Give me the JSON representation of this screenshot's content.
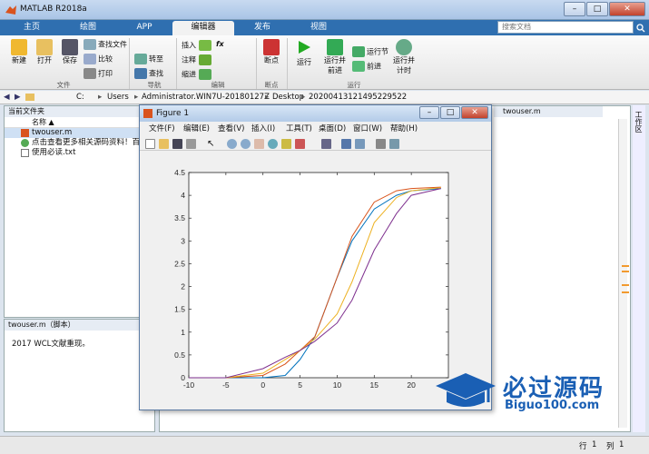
{
  "window": {
    "title": "MATLAB R2018a",
    "min": "–",
    "max": "□",
    "close": "✕"
  },
  "tabs": [
    "主页",
    "绘图",
    "APP",
    "编辑器",
    "发布",
    "视图"
  ],
  "search": {
    "placeholder": "搜索文档"
  },
  "ribbon": {
    "file": {
      "new": "新建",
      "open": "打开",
      "save": "保存",
      "find_files": "查找文件",
      "compare": "比较",
      "print": "打印",
      "group": "文件"
    },
    "nav": {
      "goto": "转至",
      "find": "查找",
      "group": "导航"
    },
    "edit": {
      "insert": "插入",
      "comment": "注释",
      "indent": "缩进",
      "fx": "fx",
      "group": "编辑"
    },
    "breakpoints": {
      "breakpoint": "断点",
      "group": "断点"
    },
    "run": {
      "run": "运行",
      "run_advance": "运行并\n前进",
      "run_section": "运行节",
      "advance": "前进",
      "run_time": "运行并\n计时",
      "group": "运行"
    }
  },
  "address": {
    "path": [
      "C:",
      "Users",
      "Administrator.WIN7U-20180127Z",
      "Desktop",
      "20200413121495229522"
    ]
  },
  "current_folder": {
    "title": "当前文件夹",
    "column": "名称 ▲",
    "files": [
      {
        "name": "twouser.m",
        "selected": true
      },
      {
        "name": "点击查看更多相关源码资料！百万",
        "selected": false
      },
      {
        "name": "使用必读.txt",
        "selected": false
      }
    ]
  },
  "details": {
    "title": "twouser.m（脚本）",
    "text": "2017 WCL文献重现。"
  },
  "editor": {
    "tab": "twouser.m"
  },
  "right_strip": {
    "label": "工作区"
  },
  "status": {
    "row_label": "行",
    "row": "1",
    "col_label": "列",
    "col": "1"
  },
  "figure": {
    "title": "Figure 1",
    "menus": [
      "文件(F)",
      "编辑(E)",
      "查看(V)",
      "插入(I)",
      "工具(T)",
      "桌面(D)",
      "窗口(W)",
      "帮助(H)"
    ]
  },
  "chart_data": {
    "type": "line",
    "xlim": [
      -10,
      25
    ],
    "ylim": [
      0,
      4.5
    ],
    "xticks": [
      -10,
      -5,
      0,
      5,
      10,
      15,
      20
    ],
    "yticks": [
      0,
      0.5,
      1,
      1.5,
      2,
      2.5,
      3,
      3.5,
      4,
      4.5
    ],
    "grid": false,
    "series": [
      {
        "color": "#0072bd",
        "x": [
          -10,
          -5,
          0,
          3,
          5,
          7,
          10,
          12,
          15,
          18,
          20,
          24
        ],
        "y": [
          0,
          0,
          0,
          0.05,
          0.4,
          0.9,
          2.2,
          3.0,
          3.7,
          4.0,
          4.1,
          4.15
        ]
      },
      {
        "color": "#d95319",
        "x": [
          -10,
          -5,
          0,
          3,
          5,
          7,
          10,
          12,
          15,
          18,
          20,
          24
        ],
        "y": [
          0,
          0,
          0.05,
          0.3,
          0.6,
          0.9,
          2.2,
          3.1,
          3.85,
          4.1,
          4.15,
          4.18
        ]
      },
      {
        "color": "#edb120",
        "x": [
          -10,
          -5,
          0,
          3,
          5,
          7,
          10,
          12,
          15,
          18,
          20,
          24
        ],
        "y": [
          0,
          0,
          0.1,
          0.4,
          0.6,
          0.85,
          1.4,
          2.1,
          3.4,
          3.95,
          4.1,
          4.17
        ]
      },
      {
        "color": "#7e2f8e",
        "x": [
          -10,
          -5,
          0,
          3,
          5,
          7,
          10,
          12,
          15,
          18,
          20,
          24
        ],
        "y": [
          0,
          0,
          0.2,
          0.45,
          0.6,
          0.8,
          1.2,
          1.7,
          2.8,
          3.6,
          4.0,
          4.15
        ]
      }
    ]
  },
  "logo": {
    "cn": "必过源码",
    "url": "Biguo100.com"
  },
  "colors": {
    "accent": "#2f6fb0",
    "logo": "#1a5fb4"
  }
}
